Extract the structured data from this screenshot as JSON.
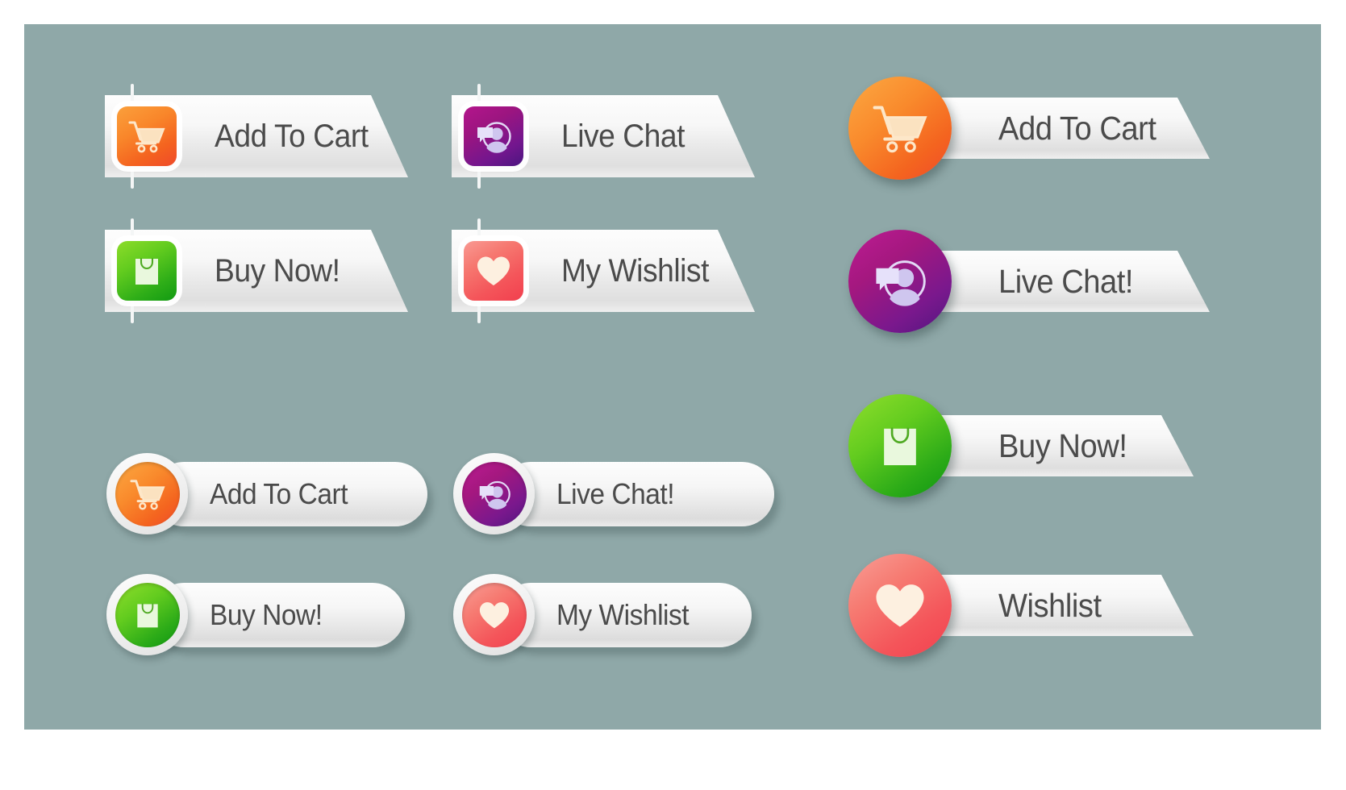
{
  "canvas": {
    "background_color": "#8fa8a8",
    "page_background": "#ffffff"
  },
  "palette": {
    "cart_orange": "#f4621f",
    "chat_purple": "#9c1580",
    "bag_green": "#2fae18",
    "heart_pink": "#f4555a",
    "label_text": "#4b4b4b",
    "plate_white": "#f7f7f7"
  },
  "groups": {
    "banner_buttons": [
      {
        "id": "add-to-cart-banner",
        "label": "Add To Cart",
        "icon": "shopping-cart-icon",
        "color_name": "orange"
      },
      {
        "id": "live-chat-banner",
        "label": "Live Chat",
        "icon": "live-chat-icon",
        "color_name": "purple"
      },
      {
        "id": "buy-now-banner",
        "label": "Buy Now!",
        "icon": "shopping-bag-icon",
        "color_name": "green"
      },
      {
        "id": "my-wishlist-banner",
        "label": "My Wishlist",
        "icon": "heart-icon",
        "color_name": "pink"
      }
    ],
    "pill_buttons": [
      {
        "id": "add-to-cart-pill",
        "label": "Add To Cart",
        "icon": "shopping-cart-icon",
        "color_name": "orange"
      },
      {
        "id": "live-chat-pill",
        "label": "Live Chat!",
        "icon": "live-chat-icon",
        "color_name": "purple"
      },
      {
        "id": "buy-now-pill",
        "label": "Buy Now!",
        "icon": "shopping-bag-icon",
        "color_name": "green"
      },
      {
        "id": "my-wishlist-pill",
        "label": "My Wishlist",
        "icon": "heart-icon",
        "color_name": "pink"
      }
    ],
    "circle_buttons": [
      {
        "id": "add-to-cart-circle",
        "label": "Add To Cart",
        "icon": "shopping-cart-icon",
        "color_name": "orange"
      },
      {
        "id": "live-chat-circle",
        "label": "Live Chat!",
        "icon": "live-chat-icon",
        "color_name": "purple"
      },
      {
        "id": "buy-now-circle",
        "label": "Buy Now!",
        "icon": "shopping-bag-icon",
        "color_name": "green"
      },
      {
        "id": "wishlist-circle",
        "label": "Wishlist",
        "icon": "heart-icon",
        "color_name": "pink"
      }
    ]
  }
}
